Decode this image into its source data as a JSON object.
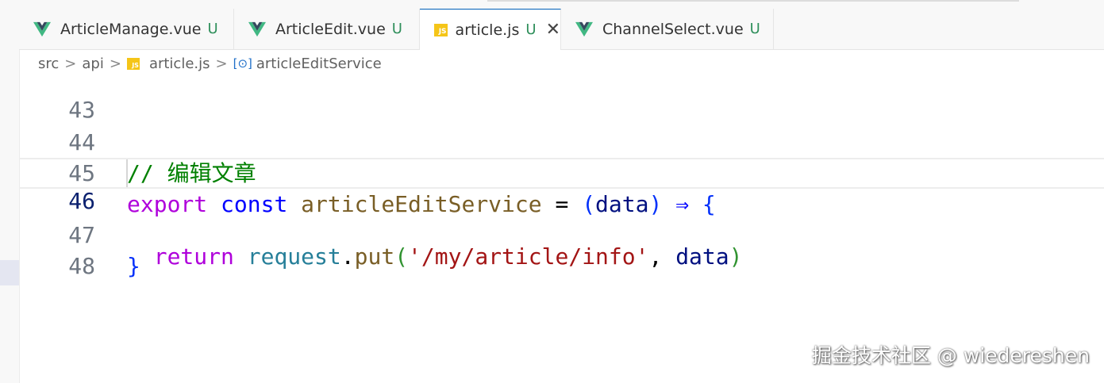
{
  "tabs": [
    {
      "label": "ArticleManage.vue",
      "status": "U",
      "icon": "vue-icon",
      "active": false
    },
    {
      "label": "ArticleEdit.vue",
      "status": "U",
      "icon": "vue-icon",
      "active": false
    },
    {
      "label": "article.js",
      "status": "U",
      "icon": "js-icon",
      "active": true,
      "close": "✕"
    },
    {
      "label": "ChannelSelect.vue",
      "status": "U",
      "icon": "vue-icon",
      "active": false
    }
  ],
  "breadcrumb": {
    "parts": [
      "src",
      "api",
      "article.js",
      "articleEditService"
    ],
    "separator": ">",
    "symbol_icon": "[⊙]"
  },
  "editor": {
    "lines": [
      {
        "number": "43",
        "current": false
      },
      {
        "number": "44",
        "current": false
      },
      {
        "number": "45",
        "current": false
      },
      {
        "number": "46",
        "current": true
      },
      {
        "number": "47",
        "current": false
      },
      {
        "number": "48",
        "current": false
      }
    ],
    "tokens": {
      "l44_comment": "// 编辑文章",
      "l45_export": "export",
      "l45_const": "const",
      "l45_name": "articleEditService",
      "l45_eq": "=",
      "l45_open": "(",
      "l45_param": "data",
      "l45_close": ")",
      "l45_arrow": "⇒",
      "l45_brace": "{",
      "l46_return": "return",
      "l46_obj": "request",
      "l46_dot": ".",
      "l46_method": "put",
      "l46_open": "(",
      "l46_str": "'/my/article/info'",
      "l46_comma": ",",
      "l46_arg": "data",
      "l46_close": ")",
      "l47_brace": "}"
    }
  },
  "watermark": "掘金技术社区 @ wiedereshen",
  "colors": {
    "vue_green": "#41b883",
    "vue_dark": "#35495e",
    "js_yellow": "#f5c518",
    "untracked": "#2f8f5b",
    "active_tab_border": "#005fb8"
  }
}
